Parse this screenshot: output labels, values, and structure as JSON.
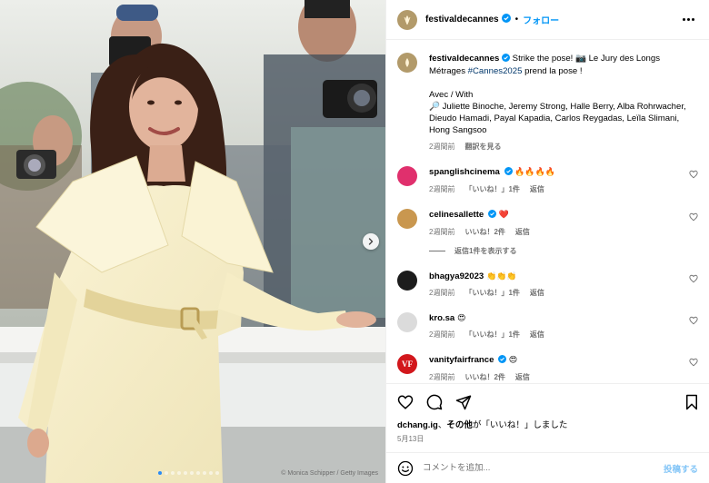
{
  "media": {
    "credit": "© Monica Schipper / Getty Images",
    "carousel_dot_count": 10,
    "carousel_active_index": 0
  },
  "header": {
    "username": "festivaldecannes",
    "separator": "•",
    "follow_label": "フォロー"
  },
  "caption": {
    "username": "festivaldecannes",
    "text_1": " Strike the pose! 📷 Le Jury des Longs Métrages ",
    "hashtag": "#Cannes2025",
    "text_2": " prend la pose !",
    "line_avec": "Avec / With",
    "jury": "🔎 Juliette Binoche, Jeremy Strong, Halle Berry, Alba Rohrwacher, Dieudo Hamadi, Payal Kapadia, Carlos Reygadas, Leïla Slimani, Hong Sangsoo",
    "time": "2週間前",
    "see_translation": "翻訳を見る"
  },
  "comments": [
    {
      "user": "spanglishcinema",
      "verified": true,
      "text": "🔥🔥🔥🔥",
      "time": "2週間前",
      "likes": "「いいね！」1件",
      "reply": "返信",
      "avatar_color": "#e0306d"
    },
    {
      "user": "celinesallette",
      "verified": true,
      "text": "❤️",
      "time": "2週間前",
      "likes": "いいね！2件",
      "reply": "返信",
      "avatar_color": "#c9974f",
      "view_replies": "返信1件を表示する"
    },
    {
      "user": "bhagya92023",
      "verified": false,
      "text": "👏👏👏",
      "time": "2週間前",
      "likes": "「いいね！」1件",
      "reply": "返信",
      "avatar_color": "#1c1c1c"
    },
    {
      "user": "kro.sa",
      "verified": false,
      "text": "😍",
      "time": "2週間前",
      "likes": "「いいね！」1件",
      "reply": "返信",
      "avatar_color": "#dbdbdb"
    },
    {
      "user": "vanityfairfrance",
      "verified": true,
      "text": "😍",
      "time": "2週間前",
      "likes": "いいね！2件",
      "reply": "返信",
      "avatar_color": "#d2171c",
      "avatar_text": "VF"
    }
  ],
  "likes_summary": {
    "user": "dchang.ig",
    "mid": "、",
    "others": "その他",
    "tail": "が「いいね！」しました"
  },
  "date": "5月13日",
  "add_comment": {
    "placeholder": "コメントを追加...",
    "post_label": "投稿する"
  },
  "colors": {
    "accent": "#0095f6",
    "verified": "#0095f6",
    "logo": "#b29a6a"
  }
}
